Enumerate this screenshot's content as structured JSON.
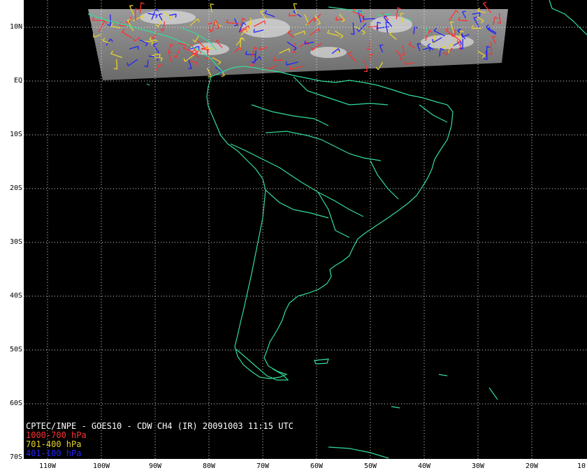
{
  "lat_labels": [
    "10N",
    "EQ",
    "10S",
    "20S",
    "30S",
    "40S",
    "50S",
    "60S",
    "70S"
  ],
  "lon_labels": [
    "110W",
    "100W",
    "90W",
    "80W",
    "70W",
    "60W",
    "50W",
    "40W",
    "30W",
    "20W",
    "10"
  ],
  "caption": {
    "title": "CPTEC/INPE - GOES10 - CDW CH4 (IR) 20091003 11:15 UTC",
    "legend": [
      {
        "label": "1000-700 hPa",
        "color": "#ff3030"
      },
      {
        "label": "701-400 hPa",
        "color": "#e8d22a"
      },
      {
        "label": "401-100 hPa",
        "color": "#2222ff"
      }
    ]
  },
  "colors": {
    "coastline": "#33dd99",
    "grid": "#ffffff",
    "ocean": "#000000",
    "satellite_strip": "#8a8a8a"
  }
}
